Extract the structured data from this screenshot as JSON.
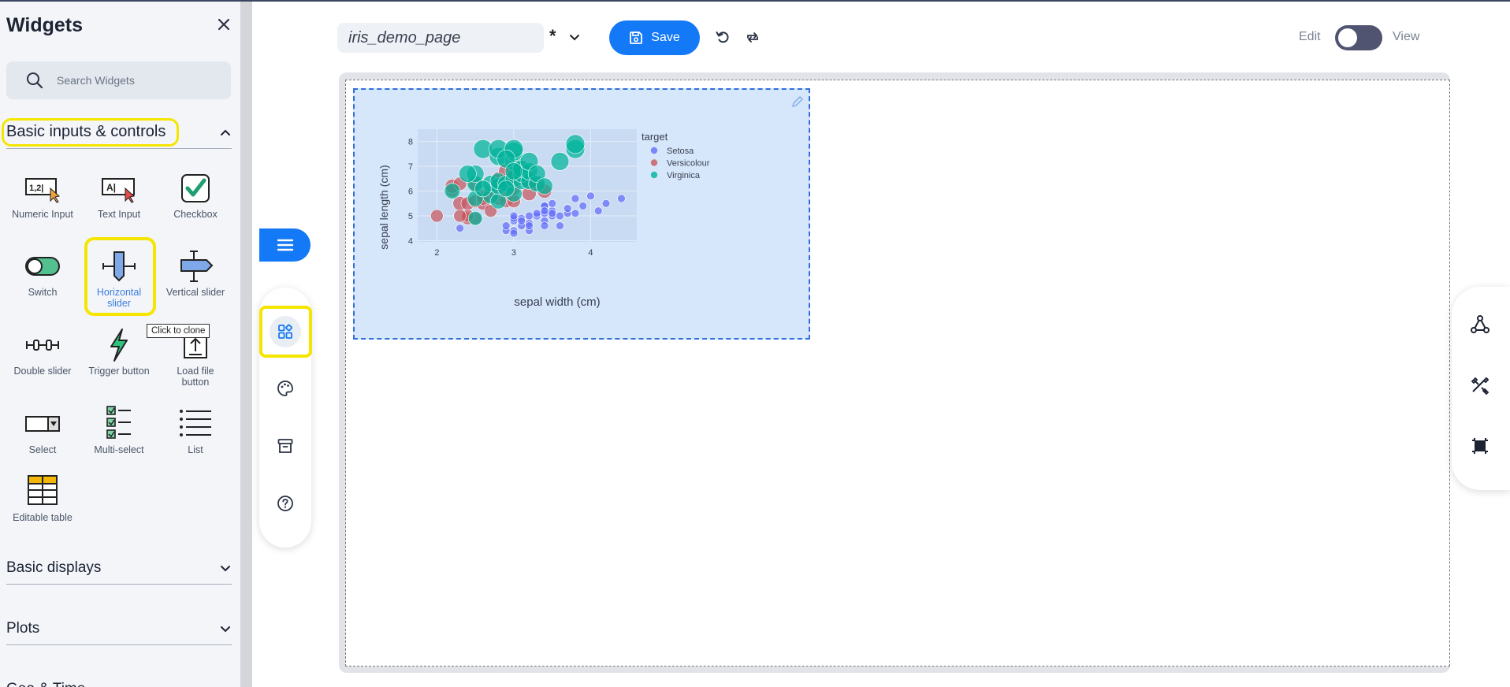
{
  "sidebar": {
    "title": "Widgets",
    "search_placeholder": "Search Widgets",
    "sections": {
      "basic_inputs": "Basic inputs & controls",
      "basic_displays": "Basic displays",
      "plots": "Plots",
      "geo_time": "Geo & Time"
    },
    "widgets": {
      "numeric_input": "Numeric Input",
      "text_input": "Text Input",
      "checkbox": "Checkbox",
      "switch": "Switch",
      "horizontal_slider": "Horizontal slider",
      "vertical_slider": "Vertical slider",
      "double_slider": "Double slider",
      "trigger_button": "Trigger button",
      "load_file_button": "Load file button",
      "select": "Select",
      "multi_select": "Multi-select",
      "list": "List",
      "editable_table": "Editable table"
    },
    "tooltip": "Click to clone"
  },
  "toolbar": {
    "page_name": "iris_demo_page",
    "dirty_marker": "*",
    "save_label": "Save",
    "mode_edit": "Edit",
    "mode_view": "View",
    "view_mode_on": false
  },
  "colors": {
    "accent": "#1479f6",
    "highlight": "#f5e600",
    "setosa": "#636efa",
    "versicolour": "#c8575e",
    "virginica": "#00b39a"
  },
  "icons": {
    "close": "close-icon",
    "search": "search-icon",
    "menu": "hamburger-icon",
    "widgets": "widgets-grid-icon",
    "theme": "palette-icon",
    "archive": "archive-icon",
    "help": "help-icon",
    "undo": "undo-icon",
    "redo": "redo-icon",
    "save": "floppy-icon",
    "network": "network-icon",
    "tools": "tools-icon",
    "select_frame": "select-frame-icon"
  },
  "chart_data": {
    "type": "scatter",
    "xlabel": "sepal width (cm)",
    "ylabel": "sepal length (cm)",
    "xlim": [
      1.75,
      4.6
    ],
    "ylim": [
      3.95,
      8.5
    ],
    "xticks": [
      2,
      3,
      4
    ],
    "yticks": [
      4,
      5,
      6,
      7,
      8
    ],
    "legend_title": "target",
    "legend_position": "right",
    "grid": true,
    "series": [
      {
        "name": "Setosa",
        "color": "#636efa",
        "points": [
          [
            2.3,
            4.5
          ],
          [
            2.9,
            4.4
          ],
          [
            3.0,
            4.4
          ],
          [
            3.2,
            4.4
          ],
          [
            3.0,
            4.3
          ],
          [
            3.1,
            4.6
          ],
          [
            3.2,
            4.7
          ],
          [
            3.0,
            4.8
          ],
          [
            3.1,
            4.9
          ],
          [
            3.0,
            4.9
          ],
          [
            3.4,
            4.8
          ],
          [
            3.2,
            5.0
          ],
          [
            3.3,
            5.0
          ],
          [
            3.4,
            5.1
          ],
          [
            3.5,
            5.0
          ],
          [
            3.6,
            5.0
          ],
          [
            3.5,
            5.2
          ],
          [
            3.4,
            5.4
          ],
          [
            3.7,
            5.1
          ],
          [
            3.8,
            5.1
          ],
          [
            3.9,
            5.4
          ],
          [
            3.7,
            5.3
          ],
          [
            3.8,
            5.7
          ],
          [
            4.0,
            5.8
          ],
          [
            4.1,
            5.2
          ],
          [
            4.2,
            5.5
          ],
          [
            4.4,
            5.7
          ],
          [
            3.4,
            4.6
          ],
          [
            3.6,
            4.6
          ],
          [
            3.0,
            5.0
          ],
          [
            3.2,
            4.6
          ],
          [
            3.5,
            5.5
          ],
          [
            3.4,
            5.4
          ],
          [
            3.5,
            5.1
          ],
          [
            3.1,
            4.8
          ],
          [
            2.9,
            4.6
          ],
          [
            3.3,
            5.1
          ],
          [
            3.4,
            5.2
          ]
        ],
        "sizes": [
          10,
          10,
          10,
          10,
          10,
          10,
          10,
          10,
          10,
          10,
          10,
          10,
          10,
          10,
          10,
          10,
          10,
          10,
          10,
          10,
          10,
          10,
          10,
          10,
          10,
          10,
          10,
          10,
          10,
          10,
          10,
          10,
          10,
          10,
          10,
          10,
          10,
          10
        ]
      },
      {
        "name": "Versicolour",
        "color": "#c8575e",
        "points": [
          [
            2.0,
            5.0
          ],
          [
            2.2,
            6.0
          ],
          [
            2.2,
            6.2
          ],
          [
            2.3,
            5.5
          ],
          [
            2.3,
            6.3
          ],
          [
            2.4,
            5.5
          ],
          [
            2.4,
            4.9
          ],
          [
            2.5,
            5.6
          ],
          [
            2.5,
            6.3
          ],
          [
            2.6,
            5.5
          ],
          [
            2.6,
            5.8
          ],
          [
            2.7,
            5.2
          ],
          [
            2.7,
            5.8
          ],
          [
            2.7,
            6.0
          ],
          [
            2.8,
            5.7
          ],
          [
            2.8,
            6.1
          ],
          [
            2.8,
            6.5
          ],
          [
            2.9,
            5.6
          ],
          [
            2.9,
            6.0
          ],
          [
            2.9,
            6.4
          ],
          [
            3.0,
            5.6
          ],
          [
            3.0,
            6.1
          ],
          [
            3.0,
            6.6
          ],
          [
            2.9,
            6.8
          ],
          [
            3.1,
            6.7
          ],
          [
            3.1,
            6.9
          ],
          [
            3.2,
            5.9
          ],
          [
            3.2,
            6.4
          ],
          [
            3.3,
            6.3
          ],
          [
            3.4,
            6.0
          ],
          [
            2.5,
            4.9
          ],
          [
            2.4,
            5.0
          ],
          [
            2.6,
            5.7
          ],
          [
            2.3,
            5.0
          ]
        ],
        "sizes": [
          16,
          16,
          18,
          18,
          17,
          17,
          16,
          17,
          18,
          17,
          17,
          16,
          17,
          18,
          17,
          18,
          18,
          17,
          18,
          19,
          17,
          18,
          19,
          19,
          19,
          19,
          18,
          19,
          18,
          18,
          16,
          16,
          17,
          16
        ]
      },
      {
        "name": "Virginica",
        "color": "#00b39a",
        "points": [
          [
            2.2,
            6.0
          ],
          [
            2.5,
            4.9
          ],
          [
            2.5,
            5.7
          ],
          [
            2.5,
            6.3
          ],
          [
            2.5,
            6.7
          ],
          [
            2.6,
            7.7
          ],
          [
            2.7,
            5.8
          ],
          [
            2.7,
            6.3
          ],
          [
            2.8,
            5.6
          ],
          [
            2.8,
            6.2
          ],
          [
            2.8,
            6.4
          ],
          [
            2.8,
            7.4
          ],
          [
            2.8,
            7.7
          ],
          [
            2.9,
            6.3
          ],
          [
            3.0,
            5.9
          ],
          [
            3.0,
            6.5
          ],
          [
            3.0,
            7.2
          ],
          [
            3.0,
            7.6
          ],
          [
            3.0,
            7.7
          ],
          [
            3.1,
            6.4
          ],
          [
            3.1,
            6.7
          ],
          [
            3.1,
            6.9
          ],
          [
            3.2,
            6.4
          ],
          [
            3.2,
            6.8
          ],
          [
            3.2,
            7.2
          ],
          [
            3.3,
            6.3
          ],
          [
            3.3,
            6.7
          ],
          [
            3.4,
            6.2
          ],
          [
            3.6,
            7.2
          ],
          [
            3.8,
            7.7
          ],
          [
            3.8,
            7.9
          ],
          [
            2.9,
            7.3
          ],
          [
            3.0,
            6.8
          ],
          [
            2.4,
            6.7
          ],
          [
            2.6,
            6.1
          ],
          [
            2.9,
            6.1
          ]
        ],
        "sizes": [
          20,
          18,
          20,
          21,
          22,
          24,
          20,
          21,
          20,
          21,
          21,
          23,
          24,
          21,
          21,
          22,
          23,
          24,
          24,
          21,
          22,
          22,
          21,
          22,
          23,
          21,
          22,
          21,
          23,
          24,
          24,
          23,
          22,
          22,
          21,
          21
        ]
      }
    ]
  }
}
